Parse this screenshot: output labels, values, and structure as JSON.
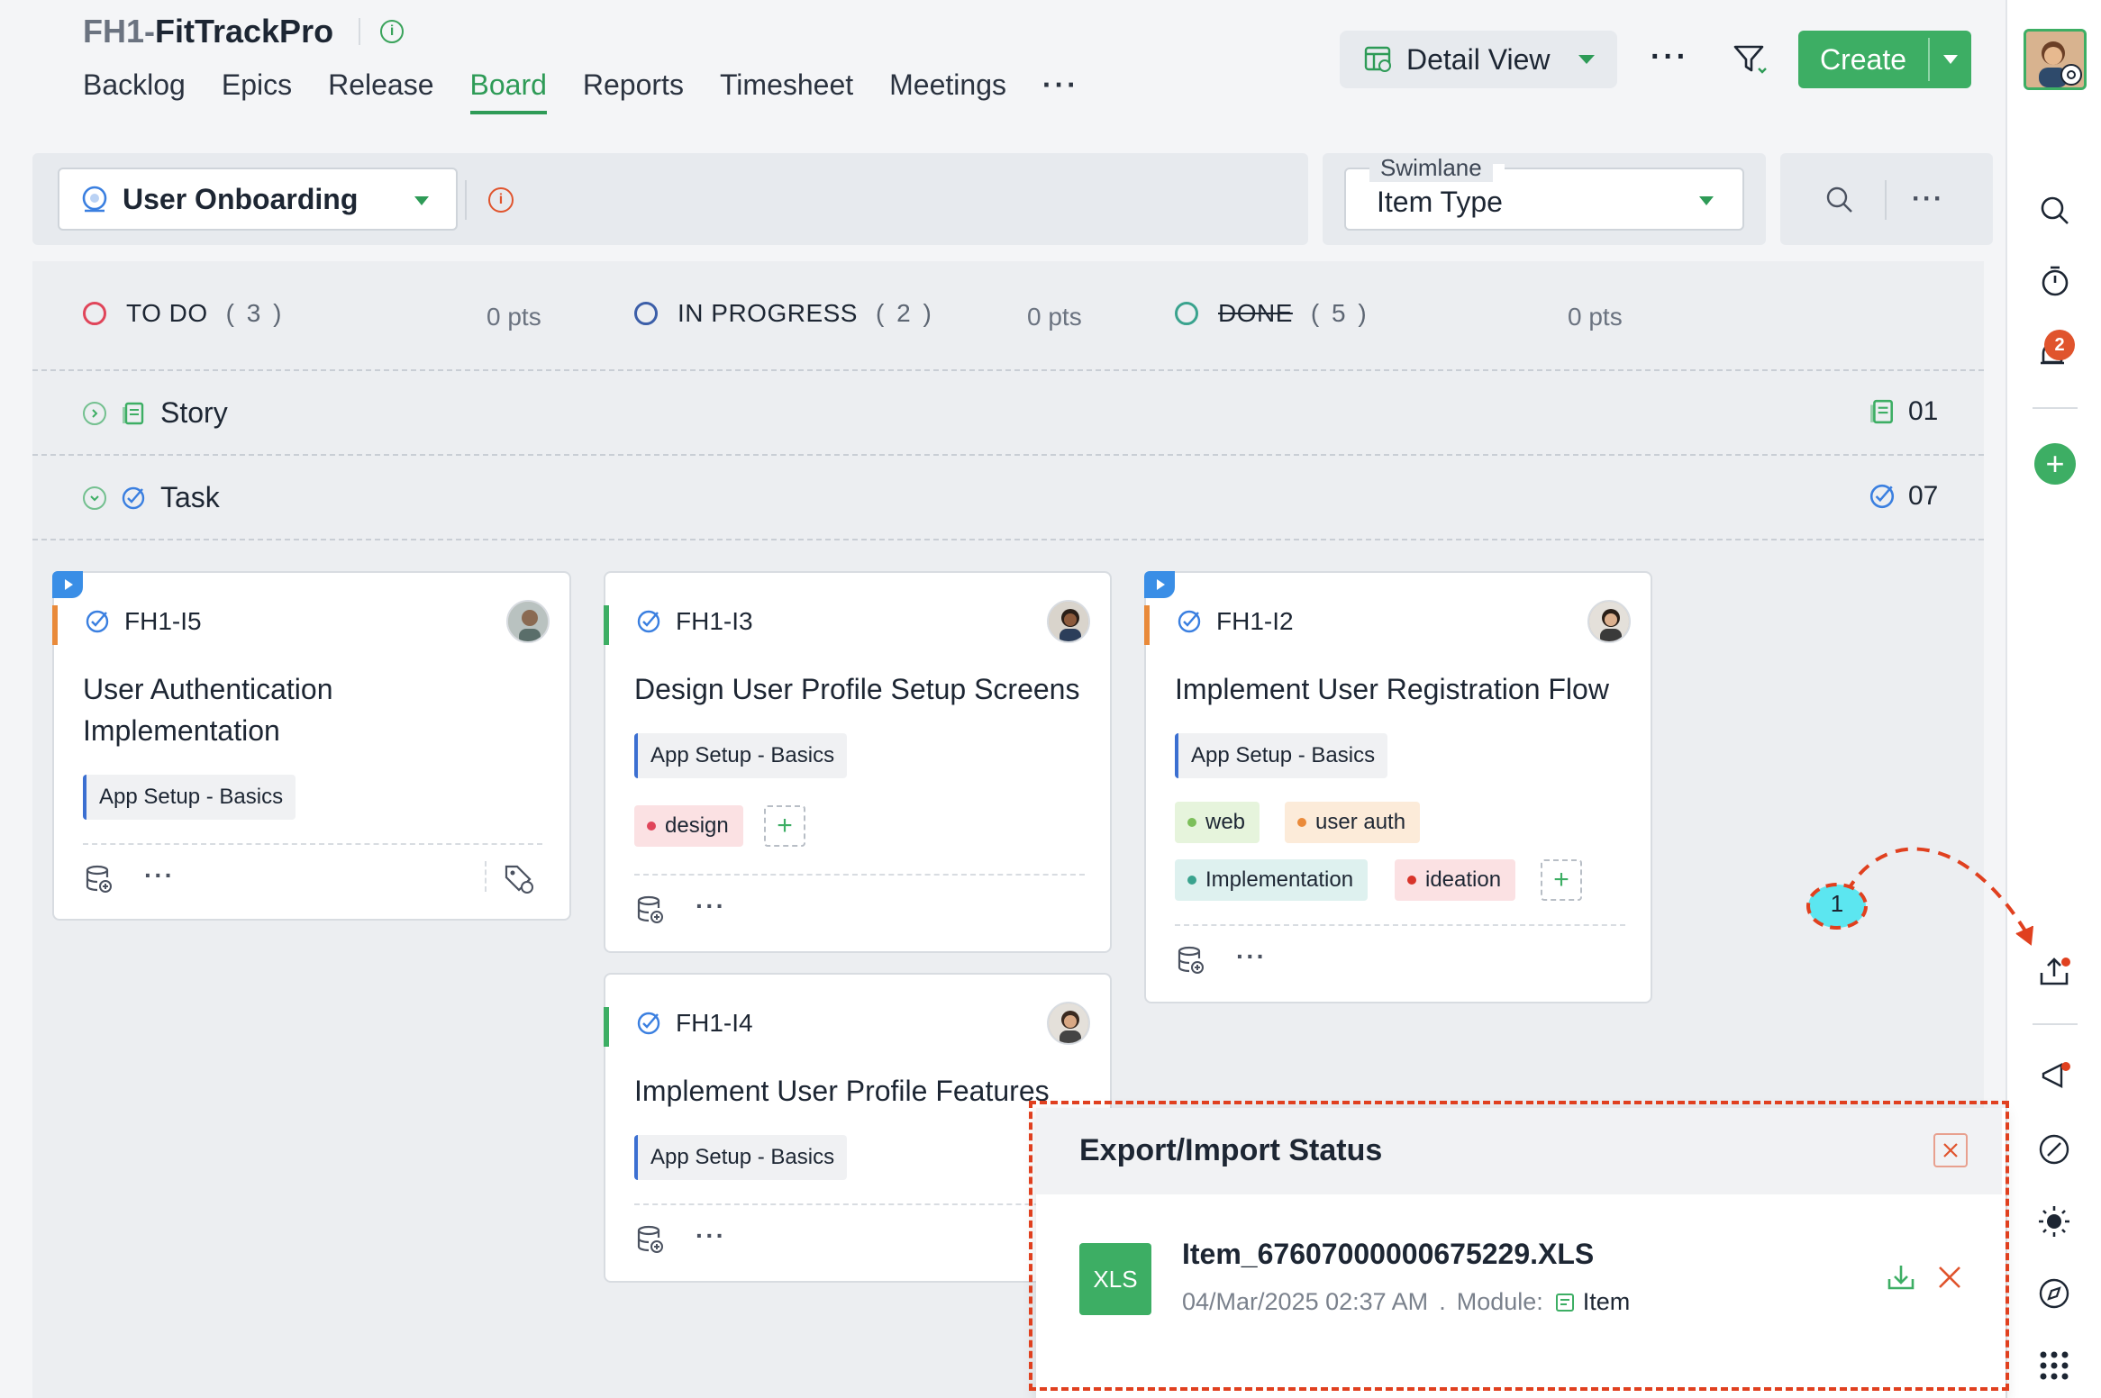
{
  "header": {
    "project_prefix": "FH1-",
    "project_name": "FitTrackPro",
    "tabs": [
      {
        "label": "Backlog"
      },
      {
        "label": "Epics"
      },
      {
        "label": "Release"
      },
      {
        "label": "Board",
        "active": true
      },
      {
        "label": "Reports"
      },
      {
        "label": "Timesheet"
      },
      {
        "label": "Meetings"
      }
    ],
    "more": "···",
    "view_label": "Detail View",
    "create_label": "Create"
  },
  "toolbar": {
    "sprint": "User Onboarding",
    "swimlane_label": "Swimlane",
    "swimlane_value": "Item Type"
  },
  "columns": [
    {
      "name": "TO DO",
      "count": "( 3 )",
      "pts": "0 pts",
      "color": "#e0455a"
    },
    {
      "name": "IN PROGRESS",
      "count": "( 2 )",
      "pts": "0 pts",
      "color": "#3b5ea8"
    },
    {
      "name": "DONE",
      "count": "( 5 )",
      "pts": "0 pts",
      "color": "#3aa38e"
    }
  ],
  "swimlanes": [
    {
      "name": "Story",
      "count": "01"
    },
    {
      "name": "Task",
      "count": "07"
    }
  ],
  "cards": [
    {
      "id": "FH1-I5",
      "title_line1": "User Authentication",
      "title_line2": "Implementation",
      "epic": "App Setup - Basics"
    },
    {
      "id": "FH1-I3",
      "title": "Design User Profile Setup Screens",
      "epic": "App Setup - Basics",
      "tags": [
        "design"
      ]
    },
    {
      "id": "FH1-I4",
      "title": "Implement User Profile Features",
      "epic": "App Setup - Basics"
    },
    {
      "id": "FH1-I2",
      "title": "Implement User Registration Flow",
      "epic": "App Setup - Basics",
      "tags": [
        "web",
        "user auth",
        "Implementation",
        "ideation"
      ]
    }
  ],
  "rail": {
    "notification_count": "2"
  },
  "annotation": {
    "step": "1"
  },
  "export_popup": {
    "title": "Export/Import Status",
    "file_type": "XLS",
    "file_name": "Item_67607000000675229.XLS",
    "timestamp": "04/Mar/2025 02:37 AM",
    "separator": ".",
    "module_label": "Module:",
    "module_value": "Item"
  },
  "colors": {
    "accent_green": "#3dae64",
    "annotation_red": "#e0401f",
    "badge_cyan": "#5ce6f0"
  }
}
